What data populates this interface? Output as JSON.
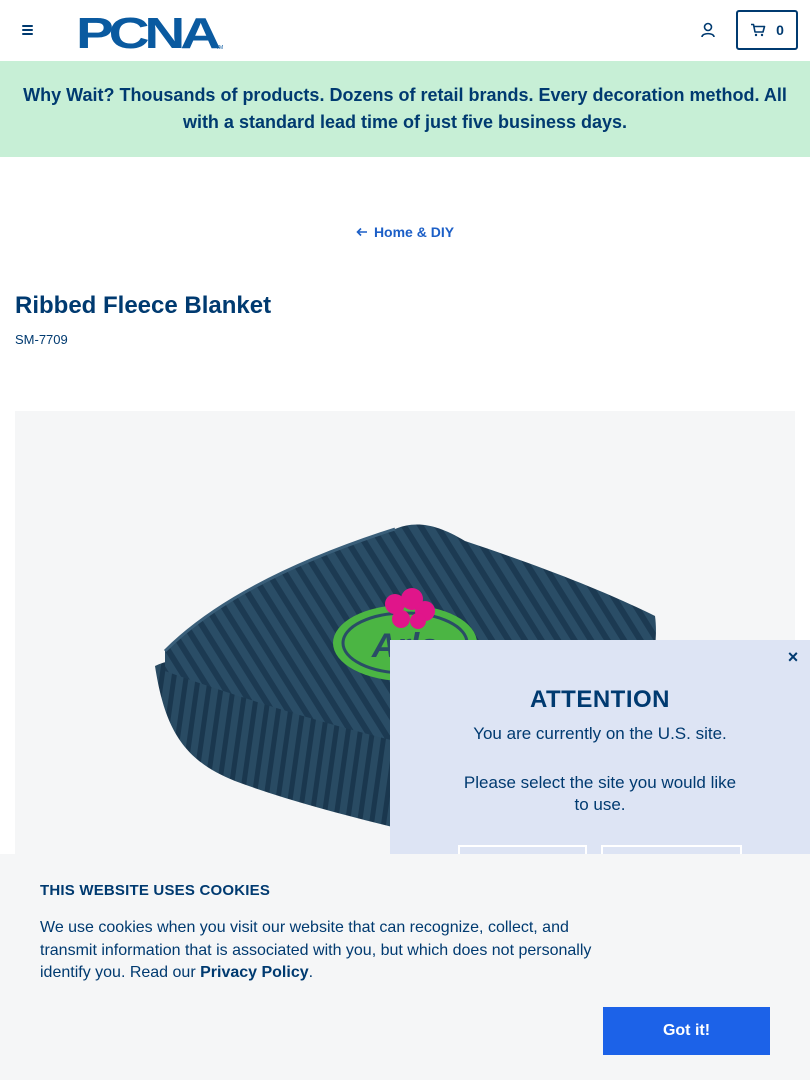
{
  "header": {
    "logo_text": "PCNA",
    "cart_count": "0"
  },
  "promo": {
    "text": "Why Wait? Thousands of products. Dozens of retail brands. Every decoration method. All with a standard lead time of just five business days."
  },
  "breadcrumb": {
    "label": "Home & DIY"
  },
  "product": {
    "title": "Ribbed Fleece Blanket",
    "sku": "SM-7709",
    "imprint_logo_text": "Arla"
  },
  "attention": {
    "close": "×",
    "title": "ATTENTION",
    "current_site": "You are currently on the U.S. site.",
    "prompt": "Please select the site you would like to use."
  },
  "cookies": {
    "title": "THIS WEBSITE USES COOKIES",
    "body": "We use cookies when you visit our website that can recognize, collect, and transmit information that is associated with you, but which does not personally identify you. Read our ",
    "link": "Privacy Policy",
    "period": ".",
    "button": "Got it!"
  },
  "colors": {
    "navy": "#003a70",
    "promo_bg": "#c7efd6",
    "modal_bg": "#dde4f4",
    "button_blue": "#1c62e8",
    "link_blue": "#1c5fc7"
  }
}
